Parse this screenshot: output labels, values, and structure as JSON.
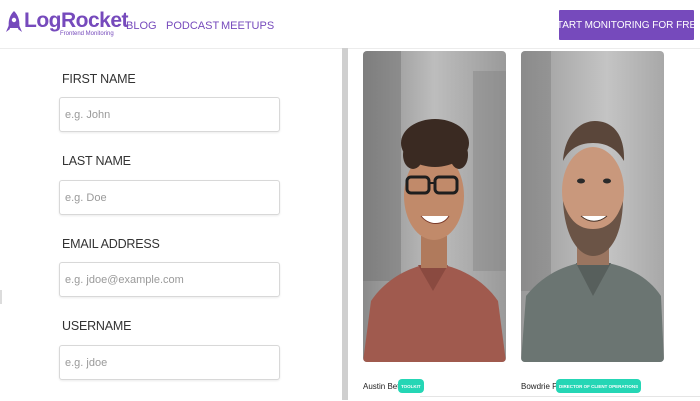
{
  "header": {
    "logo_text": "LogRocket",
    "logo_subtitle": "Frontend Monitoring",
    "nav": [
      "BLOG",
      "PODCAST",
      "MEETUPS"
    ],
    "cta_label": "START MONITORING FOR FREE",
    "brand_color": "#764abc"
  },
  "form": {
    "fields": [
      {
        "label": "FIRST NAME",
        "placeholder": "e.g. John",
        "value": ""
      },
      {
        "label": "LAST NAME",
        "placeholder": "e.g. Doe",
        "value": ""
      },
      {
        "label": "EMAIL ADDRESS",
        "placeholder": "e.g. jdoe@example.com",
        "value": ""
      },
      {
        "label": "USERNAME",
        "placeholder": "e.g. jdoe",
        "value": ""
      }
    ]
  },
  "team": [
    {
      "name": "Austin Betzer",
      "role": "TOOLKIT",
      "badge_color": "#25d6b5",
      "photo_icon": "person-portrait"
    },
    {
      "name": "Bowdrie Price",
      "role": "DIRECTOR OF CLIENT OPERATIONS",
      "badge_color": "#25d6b5",
      "photo_icon": "person-portrait"
    }
  ]
}
